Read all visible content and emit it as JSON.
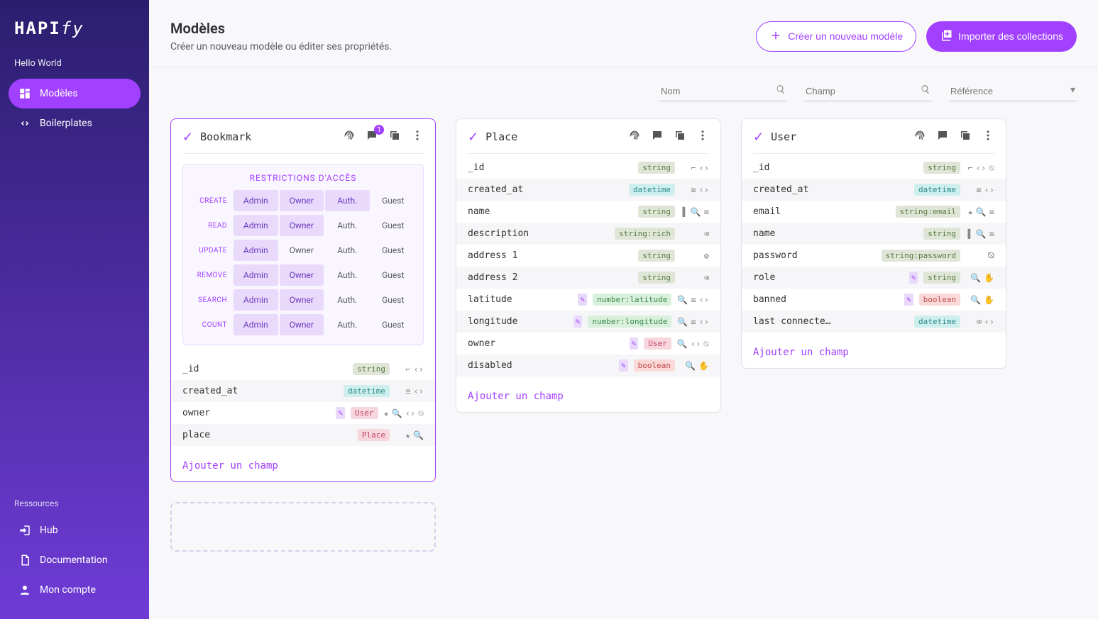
{
  "brand": "HAPIfy",
  "project": "Hello World",
  "nav": {
    "models": "Modèles",
    "boilerplates": "Boilerplates",
    "resourcesLabel": "Ressources",
    "hub": "Hub",
    "documentation": "Documentation",
    "account": "Mon compte"
  },
  "page": {
    "title": "Modèles",
    "subtitle": "Créer un nouveau modèle ou éditer ses propriétés.",
    "createBtn": "Créer un nouveau modèle",
    "importBtn": "Importer des collections"
  },
  "filters": {
    "name": "Nom",
    "field": "Champ",
    "reference": "Référence"
  },
  "roles": [
    "Admin",
    "Owner",
    "Auth.",
    "Guest"
  ],
  "actions": [
    "CREATE",
    "READ",
    "UPDATE",
    "REMOVE",
    "SEARCH",
    "COUNT"
  ],
  "models": [
    {
      "name": "Bookmark",
      "active": true,
      "commentBadge": "1",
      "access": {
        "CREATE": [
          true,
          true,
          true,
          false
        ],
        "READ": [
          true,
          true,
          false,
          false
        ],
        "UPDATE": [
          true,
          false,
          false,
          false
        ],
        "REMOVE": [
          true,
          true,
          false,
          false
        ],
        "SEARCH": [
          true,
          true,
          false,
          false
        ],
        "COUNT": [
          true,
          true,
          false,
          false
        ]
      },
      "accessTitle": "RESTRICTIONS D'ACCÈS",
      "fields": [
        {
          "name": "_id",
          "type": "string",
          "typeClass": "type-string",
          "flags": [
            "key",
            "code"
          ]
        },
        {
          "name": "created_at",
          "type": "datetime",
          "typeClass": "type-datetime",
          "flags": [
            "sort",
            "code"
          ]
        },
        {
          "name": "owner",
          "type": "User",
          "typeClass": "type-ref",
          "note": true,
          "flags": [
            "star",
            "search",
            "code",
            "stop"
          ]
        },
        {
          "name": "place",
          "type": "Place",
          "typeClass": "type-ref",
          "flags": [
            "star",
            "search"
          ]
        }
      ],
      "addField": "Ajouter un champ"
    },
    {
      "name": "Place",
      "active": false,
      "fields": [
        {
          "name": "_id",
          "type": "string",
          "typeClass": "type-string",
          "flags": [
            "key",
            "code"
          ]
        },
        {
          "name": "created_at",
          "type": "datetime",
          "typeClass": "type-datetime",
          "flags": [
            "sort",
            "code"
          ]
        },
        {
          "name": "name",
          "type": "string",
          "typeClass": "type-string",
          "flags": [
            "label",
            "search",
            "sort"
          ]
        },
        {
          "name": "description",
          "type": "string:rich",
          "typeClass": "type-string",
          "flags": [
            "null"
          ]
        },
        {
          "name": "address 1",
          "type": "string",
          "typeClass": "type-string",
          "flags": [
            "gear"
          ]
        },
        {
          "name": "address 2",
          "type": "string",
          "typeClass": "type-string",
          "flags": [
            "null"
          ]
        },
        {
          "name": "latitude",
          "type": "number:latitude",
          "typeClass": "type-number",
          "note": true,
          "flags": [
            "search",
            "sort",
            "code"
          ]
        },
        {
          "name": "longitude",
          "type": "number:longitude",
          "typeClass": "type-number",
          "note": true,
          "flags": [
            "search",
            "sort",
            "code"
          ]
        },
        {
          "name": "owner",
          "type": "User",
          "typeClass": "type-ref",
          "note": true,
          "flags": [
            "search",
            "code",
            "stop"
          ]
        },
        {
          "name": "disabled",
          "type": "boolean",
          "typeClass": "type-bool",
          "note": true,
          "flags": [
            "search",
            "hand"
          ]
        }
      ],
      "addField": "Ajouter un champ"
    },
    {
      "name": "User",
      "active": false,
      "fields": [
        {
          "name": "_id",
          "type": "string",
          "typeClass": "type-string",
          "flags": [
            "key",
            "code",
            "stop"
          ]
        },
        {
          "name": "created_at",
          "type": "datetime",
          "typeClass": "type-datetime",
          "flags": [
            "sort",
            "code"
          ]
        },
        {
          "name": "email",
          "type": "string:email",
          "typeClass": "type-string",
          "flags": [
            "star",
            "search",
            "sort"
          ]
        },
        {
          "name": "name",
          "type": "string",
          "typeClass": "type-string",
          "flags": [
            "label",
            "search",
            "sort"
          ]
        },
        {
          "name": "password",
          "type": "string:password",
          "typeClass": "type-string",
          "flags": [
            "hidden"
          ]
        },
        {
          "name": "role",
          "type": "string",
          "typeClass": "type-string",
          "note": true,
          "flags": [
            "search",
            "hand"
          ]
        },
        {
          "name": "banned",
          "type": "boolean",
          "typeClass": "type-bool",
          "note": true,
          "flags": [
            "search",
            "hand"
          ]
        },
        {
          "name": "last connecte…",
          "type": "datetime",
          "typeClass": "type-datetime",
          "flags": [
            "null",
            "code"
          ]
        }
      ],
      "addField": "Ajouter un champ"
    }
  ]
}
